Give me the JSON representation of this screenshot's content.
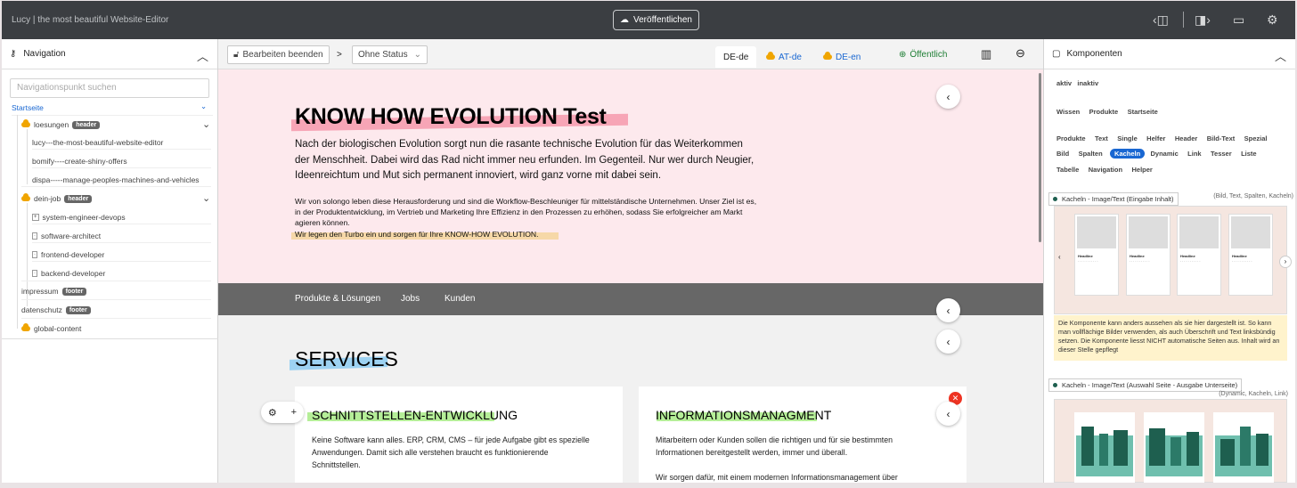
{
  "app": {
    "title": "Lucy | the most beautiful Website-Editor",
    "publish_label": "Veröffentlichen"
  },
  "icons": {
    "sidebar_left": "panel-left-icon",
    "sidebar_right": "panel-right-icon",
    "desktop": "monitor-icon",
    "settings": "gear-icon"
  },
  "navigation": {
    "title": "Navigation",
    "search_placeholder": "Navigationspunkt suchen",
    "root": "Startseite",
    "items": [
      {
        "label": "loesungen",
        "badge": "header"
      },
      {
        "label": "lucy---the-most-beautiful-website-editor"
      },
      {
        "label": "bomify----create-shiny-offers"
      },
      {
        "label": "dispa-----manage-peoples-machines-and-vehicles"
      },
      {
        "label": "dein-job",
        "badge": "header"
      },
      {
        "label": "system-engineer-devops"
      },
      {
        "label": "software-architect"
      },
      {
        "label": "frontend-developer"
      },
      {
        "label": "backend-developer"
      },
      {
        "label": "impressum",
        "badge": "footer"
      },
      {
        "label": "datenschutz",
        "badge": "footer"
      },
      {
        "label": "global-content"
      }
    ]
  },
  "toolbar": {
    "end_edit": "Bearbeiten beenden",
    "breadcrumb_sep": ">",
    "status": "Ohne Status",
    "langs": [
      "DE-de",
      "AT-de",
      "DE-en"
    ],
    "public": "Öffentlich"
  },
  "page": {
    "heading": "KNOW HOW EVOLUTION Test",
    "lead": "Nach der biologischen Evolution sorgt nun die rasante technische Evolution für das Weiterkommen der Menschheit. Dabei wird das Rad nicht immer neu erfunden. Im Gegenteil. Nur wer durch Neugier, Ideenreichtum und Mut sich permanent innoviert, wird ganz vorne mit dabei sein.",
    "body": "Wir von solongo leben diese Herausforderung und sind die Workflow-Beschleuniger für mittelständische Unternehmen. Unser Ziel ist es, in der Produktentwicklung, im Vertrieb und Marketing Ihre Effizienz in den Prozessen zu erhöhen, sodass Sie erfolgreicher am Markt agieren können.",
    "body_highlight": "Wir legen den Turbo ein und sorgen für Ihre KNOW-HOW EVOLUTION.",
    "menu": [
      "Produkte & Lösungen",
      "Jobs",
      "Kunden"
    ],
    "services": "SERVICES",
    "card1_title": "SCHNITTSTELLEN-ENTWICKLUNG",
    "card1_text": "Keine Software kann alles. ERP, CRM, CMS – für jede Aufgabe gibt es spezielle Anwendungen. Damit sich alle verstehen braucht es funktionierende Schnittstellen.",
    "card2_title": "INFORMATIONSMANAGMENT",
    "card2_text1": "Mitarbeitern oder Kunden sollen die richtigen und für sie bestimmten Informationen bereitgestellt werden, immer und überall.",
    "card2_text2": "Wir sorgen dafür, mit einem modernen Informationsmanagement über"
  },
  "components": {
    "title": "Komponenten",
    "filter1": [
      "aktiv",
      "inaktiv"
    ],
    "filter2": [
      "Wissen",
      "Produkte",
      "Startseite"
    ],
    "tags_row1": [
      "Produkte",
      "Text",
      "Single",
      "Helfer",
      "Header",
      "Bild-Text",
      "Spezial"
    ],
    "tags_row2": [
      "Bild",
      "Spalten",
      "Kacheln",
      "Dynamic",
      "Link",
      "Tesser",
      "Liste"
    ],
    "tags_row3": [
      "Tabelle",
      "Navigation",
      "Helper"
    ],
    "active_tag": "Kacheln",
    "preview1_title": "Kacheln - Image/Text (Eingabe Inhalt)",
    "preview1_tags": "(Bild, Text, Spalten, Kacheln)",
    "tile_headline": "Headline",
    "warning": "Die Komponente kann anders aussehen als sie hier dargestellt ist. So kann man vollflächige Bilder verwenden, als auch Überschrift und Text linksbündig setzen. Die Komponente liesst NICHT automatische Seiten aus. Inhalt wird an dieser Stelle gepflegt",
    "preview2_title": "Kacheln - Image/Text (Auswahl Seite - Ausgabe Unterseite)",
    "preview2_tags": "(Dynamic, Kacheln, Link)"
  }
}
